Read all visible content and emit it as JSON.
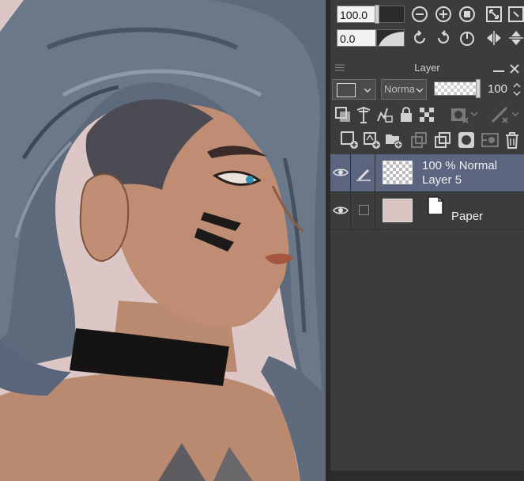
{
  "navigator": {
    "zoom_value": "100.0",
    "rotate_value": "0.0",
    "zoom_buttons": [
      "zoom-out-icon",
      "zoom-in-icon",
      "actual-size-icon",
      "fit-window-icon"
    ],
    "rotate_buttons": [
      "rotate-left-icon",
      "rotate-right-icon",
      "reset-rotation-icon",
      "flip-horizontal-icon",
      "flip-vertical-icon"
    ]
  },
  "layer_panel": {
    "title": "Layer",
    "blend_mode": "Normal",
    "opacity": "100",
    "opacity_fraction": 1.0,
    "layers": [
      {
        "line1": "100 % Normal",
        "line2": "Layer 5",
        "selected": true,
        "visible": true,
        "editing": true,
        "thumb": "checker"
      },
      {
        "line1": "",
        "line2": "Paper",
        "selected": false,
        "visible": true,
        "editing": false,
        "thumb_color": "#d9c4c4"
      }
    ]
  },
  "colors": {
    "panel_bg": "#3c3c3c",
    "selected_row": "#5b6580",
    "canvas_bg": "#dcc7c6",
    "paper_color": "#d9c4c4"
  }
}
